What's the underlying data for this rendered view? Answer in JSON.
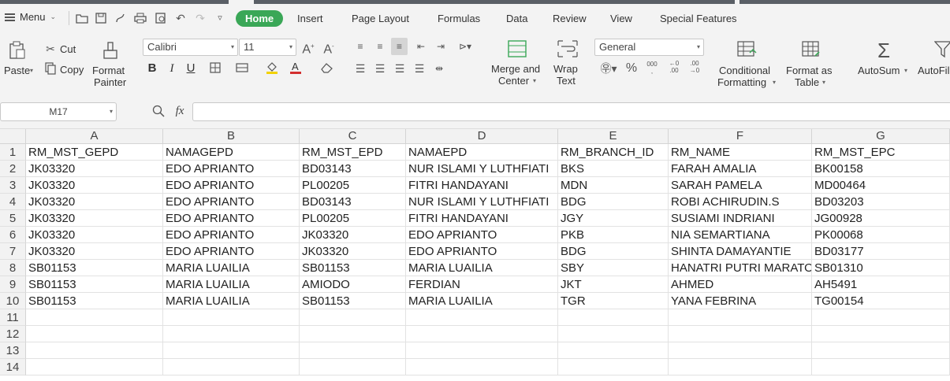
{
  "menubar": {
    "menu_label": "Menu",
    "tabs": [
      "Home",
      "Insert",
      "Page Layout",
      "Formulas",
      "Data",
      "Review",
      "View",
      "Special Features"
    ],
    "active_tab": "Home"
  },
  "ribbon": {
    "paste": "Paste",
    "cut": "Cut",
    "copy": "Copy",
    "format_painter_1": "Format",
    "format_painter_2": "Painter",
    "font_name": "Calibri",
    "font_size": "11",
    "bold": "B",
    "italic": "I",
    "underline": "U",
    "merge_1": "Merge and",
    "merge_2": "Center",
    "wrap_1": "Wrap",
    "wrap_2": "Text",
    "number_format": "General",
    "conditional_1": "Conditional",
    "conditional_2": "Formatting",
    "format_table_1": "Format as",
    "format_table_2": "Table",
    "autosum": "AutoSum",
    "autofilter": "AutoFil"
  },
  "formula_bar": {
    "name_box": "M17",
    "fx": "fx",
    "value": ""
  },
  "sheet": {
    "columns": [
      "A",
      "B",
      "C",
      "D",
      "E",
      "F",
      "G"
    ],
    "row_numbers": [
      "1",
      "2",
      "3",
      "4",
      "5",
      "6",
      "7",
      "8",
      "9",
      "10",
      "11",
      "12",
      "13",
      "14"
    ],
    "rows": [
      [
        "RM_MST_GEPD",
        "NAMAGEPD",
        "RM_MST_EPD",
        "NAMAEPD",
        "RM_BRANCH_ID",
        "RM_NAME",
        "RM_MST_EPC"
      ],
      [
        "JK03320",
        "EDO APRIANTO",
        "BD03143",
        "NUR ISLAMI Y LUTHFIATI",
        "BKS",
        "FARAH AMALIA",
        "BK00158"
      ],
      [
        "JK03320",
        "EDO APRIANTO",
        "PL00205",
        "FITRI HANDAYANI",
        "MDN",
        "SARAH PAMELA",
        "MD00464"
      ],
      [
        "JK03320",
        "EDO APRIANTO",
        "BD03143",
        "NUR ISLAMI Y LUTHFIATI",
        "BDG",
        "ROBI ACHIRUDIN.S",
        "BD03203"
      ],
      [
        "JK03320",
        "EDO APRIANTO",
        "PL00205",
        "FITRI HANDAYANI",
        "JGY",
        "SUSIAMI INDRIANI",
        "JG00928"
      ],
      [
        "JK03320",
        "EDO APRIANTO",
        "JK03320",
        "EDO APRIANTO",
        "PKB",
        "NIA SEMARTIANA",
        "PK00068"
      ],
      [
        "JK03320",
        "EDO APRIANTO",
        "JK03320",
        "EDO APRIANTO",
        "BDG",
        "SHINTA DAMAYANTIE",
        "BD03177"
      ],
      [
        "SB01153",
        "MARIA LUAILIA",
        "SB01153",
        "MARIA LUAILIA",
        "SBY",
        "HANATRI PUTRI MARATO",
        "SB01310"
      ],
      [
        "SB01153",
        "MARIA LUAILIA",
        "AMIODO",
        "FERDIAN",
        "JKT",
        "AHMED",
        "AH5491"
      ],
      [
        "SB01153",
        "MARIA LUAILIA",
        "SB01153",
        "MARIA LUAILIA",
        "TGR",
        "YANA FEBRINA",
        "TG00154"
      ],
      [
        "",
        "",
        "",
        "",
        "",
        "",
        ""
      ],
      [
        "",
        "",
        "",
        "",
        "",
        "",
        ""
      ],
      [
        "",
        "",
        "",
        "",
        "",
        "",
        ""
      ],
      [
        "",
        "",
        "",
        "",
        "",
        "",
        ""
      ]
    ]
  }
}
